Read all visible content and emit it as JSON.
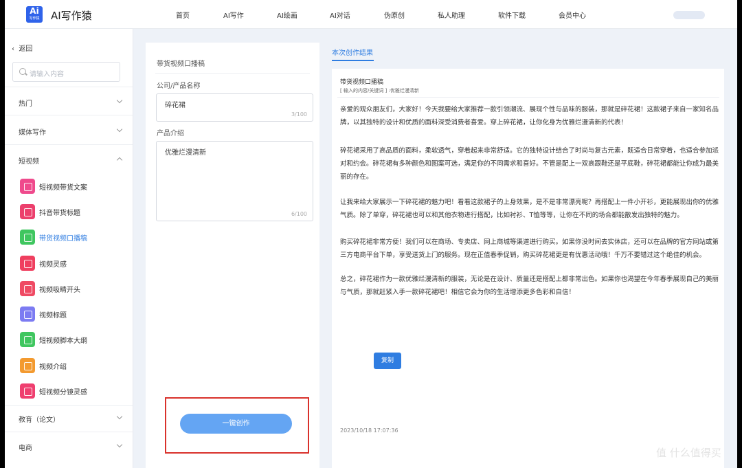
{
  "header": {
    "logo_text": "Ai",
    "logo_subtext": "写作猿",
    "brand": "AI写作猿",
    "nav": [
      "首页",
      "AI写作",
      "AI绘画",
      "AI对话",
      "伪原创",
      "私人助理",
      "软件下载",
      "会员中心"
    ]
  },
  "sidebar": {
    "back": "返回",
    "search_placeholder": "请输入内容",
    "sections": [
      {
        "label": "热门"
      },
      {
        "label": "媒体写作"
      },
      {
        "label": "短视频"
      }
    ],
    "items": [
      {
        "label": "短视频带货文案",
        "color": "#ef4a8c"
      },
      {
        "label": "抖音带货标题",
        "color": "#ec3f6c"
      },
      {
        "label": "带货视频口播稿",
        "color": "#3fc65f"
      },
      {
        "label": "视频灵感",
        "color": "#ef3f5f"
      },
      {
        "label": "视频吸睛开头",
        "color": "#ef4a63"
      },
      {
        "label": "视频标题",
        "color": "#7c7bf2"
      },
      {
        "label": "短视频脚本大纲",
        "color": "#3fc65f"
      },
      {
        "label": "视频介绍",
        "color": "#f39a2f"
      },
      {
        "label": "短视频分镜灵感",
        "color": "#ef3f6f"
      }
    ],
    "bottom_sections": [
      {
        "label": "教育（论文）"
      },
      {
        "label": "电商"
      }
    ]
  },
  "form": {
    "title": "带货视频口播稿",
    "company_label": "公司/产品名称",
    "company_value": "碎花裙",
    "company_count": "3/100",
    "intro_label": "产品介绍",
    "intro_value": "优雅烂漫清新",
    "intro_count": "6/100",
    "generate_button": "一键创作"
  },
  "result": {
    "tab": "本次创作结果",
    "title": "带货视频口播稿",
    "subtitle": "[ 输入的内容/关键词 ] :优雅烂漫清新",
    "paragraphs": [
      "亲爱的观众朋友们，大家好！今天我要给大家推荐一款引领潮流、展现个性与品味的服装，那就是碎花裙！这款裙子来自一家知名品牌，以其独特的设计和优质的面料深受消费者喜爱。穿上碎花裙，让你化身为优雅烂漫清新的代表！",
      "碎花裙采用了高品质的面料，柔软透气，穿着起来非常舒适。它的独特设计结合了时尚与复古元素，既适合日常穿着，也适合参加派对和约会。碎花裙有多种颜色和图案可选，满足你的不同需求和喜好。不管是配上一双高跟鞋还是平底鞋，碎花裙都能让你成为最美丽的存在。",
      "让我来给大家展示一下碎花裙的魅力吧！看看这款裙子的上身效果，是不是非常漂亮呢？再搭配上一件小开衫，更能展现出你的优雅气质。除了单穿，碎花裙也可以和其他衣物进行搭配，比如衬衫、T恤等等，让你在不同的场合都能散发出独特的魅力。",
      "购买碎花裙非常方便！我们可以在商场、专卖店、网上商城等渠道进行购买。如果你没时间去实体店，还可以在品牌的官方网站或第三方电商平台下单，享受送货上门的服务。现在正值春季促销，购买碎花裙更是有优惠活动哦！千万不要错过这个绝佳的机会。",
      "总之，碎花裙作为一款优雅烂漫清新的服装，无论是在设计、质量还是搭配上都非常出色。如果你也渴望在今年春季展现自己的美丽与气质，那就赶紧入手一款碎花裙吧！相信它会为你的生活增添更多色彩和自信！"
    ],
    "timestamp": "2023/10/18 17:07:36",
    "copy_button": "复制"
  },
  "watermark": "值 什么值得买"
}
